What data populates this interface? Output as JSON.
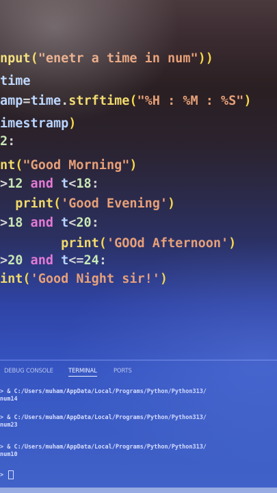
{
  "code_lines": [
    {
      "parts": [
        [
          "fn",
          "nput"
        ],
        [
          "par",
          "("
        ],
        [
          "str",
          "\"enetr a time in num\""
        ],
        [
          "par",
          "))"
        ]
      ]
    },
    {
      "parts": [
        [
          "var",
          "time"
        ]
      ]
    },
    {
      "parts": [
        [
          "var",
          "amp"
        ],
        [
          "op",
          "="
        ],
        [
          "var",
          "time"
        ],
        [
          "op",
          "."
        ],
        [
          "fn",
          "strftime"
        ],
        [
          "par",
          "("
        ],
        [
          "str",
          "\"%H : %M : %S\""
        ],
        [
          "par",
          ")"
        ]
      ]
    },
    {
      "parts": [
        [
          "var",
          "imestramp"
        ],
        [
          "par",
          ")"
        ]
      ]
    },
    {
      "parts": [
        [
          "num",
          "2"
        ],
        [
          "op",
          ":"
        ]
      ]
    },
    {
      "parts": [
        [
          "fn",
          "nt"
        ],
        [
          "par",
          "("
        ],
        [
          "str",
          "\"Good Morning\""
        ],
        [
          "par",
          ")"
        ]
      ]
    },
    {
      "parts": [
        [
          "op",
          ">"
        ],
        [
          "num",
          "12"
        ],
        [
          "kw",
          " and "
        ],
        [
          "var",
          "t"
        ],
        [
          "op",
          "<"
        ],
        [
          "num",
          "18"
        ],
        [
          "op",
          ":"
        ]
      ]
    },
    {
      "parts": [
        [
          "fn",
          "  print"
        ],
        [
          "par",
          "("
        ],
        [
          "str",
          "'Good Evening'"
        ],
        [
          "par",
          ")"
        ]
      ]
    },
    {
      "parts": [
        [
          "op",
          ">"
        ],
        [
          "num",
          "18"
        ],
        [
          "kw",
          " and "
        ],
        [
          "var",
          "t"
        ],
        [
          "op",
          "<"
        ],
        [
          "num",
          "20"
        ],
        [
          "op",
          ":"
        ]
      ]
    },
    {
      "parts": [
        [
          "fn",
          "        print"
        ],
        [
          "par",
          "("
        ],
        [
          "str",
          "'GOOd Afternoon'"
        ],
        [
          "par",
          ")"
        ]
      ]
    },
    {
      "parts": [
        [
          "op",
          ">"
        ],
        [
          "num",
          "20"
        ],
        [
          "kw",
          " and "
        ],
        [
          "var",
          "t"
        ],
        [
          "op",
          "<="
        ],
        [
          "num",
          "24"
        ],
        [
          "op",
          ":"
        ]
      ]
    },
    {
      "parts": [
        [
          "fn",
          "int"
        ],
        [
          "par",
          "("
        ],
        [
          "str",
          "'Good Night sir!'"
        ],
        [
          "par",
          ")"
        ]
      ]
    }
  ],
  "panel": {
    "tabs": [
      "DEBUG CONSOLE",
      "TERMINAL",
      "PORTS"
    ],
    "active_tab": "TERMINAL",
    "terminal_lines": [
      "> & C:/Users/muham/AppData/Local/Programs/Python/Python313/",
      "num14",
      "> & C:/Users/muham/AppData/Local/Programs/Python/Python313/",
      "num23",
      "> & C:/Users/muham/AppData/Local/Programs/Python/Python313/",
      "num10",
      "> "
    ]
  },
  "colors": {
    "keyword": "#e47ad6",
    "function": "#f1da6a",
    "string": "#e7a078",
    "variable": "#b9d5ff",
    "terminal_bg": "#3655c2"
  }
}
